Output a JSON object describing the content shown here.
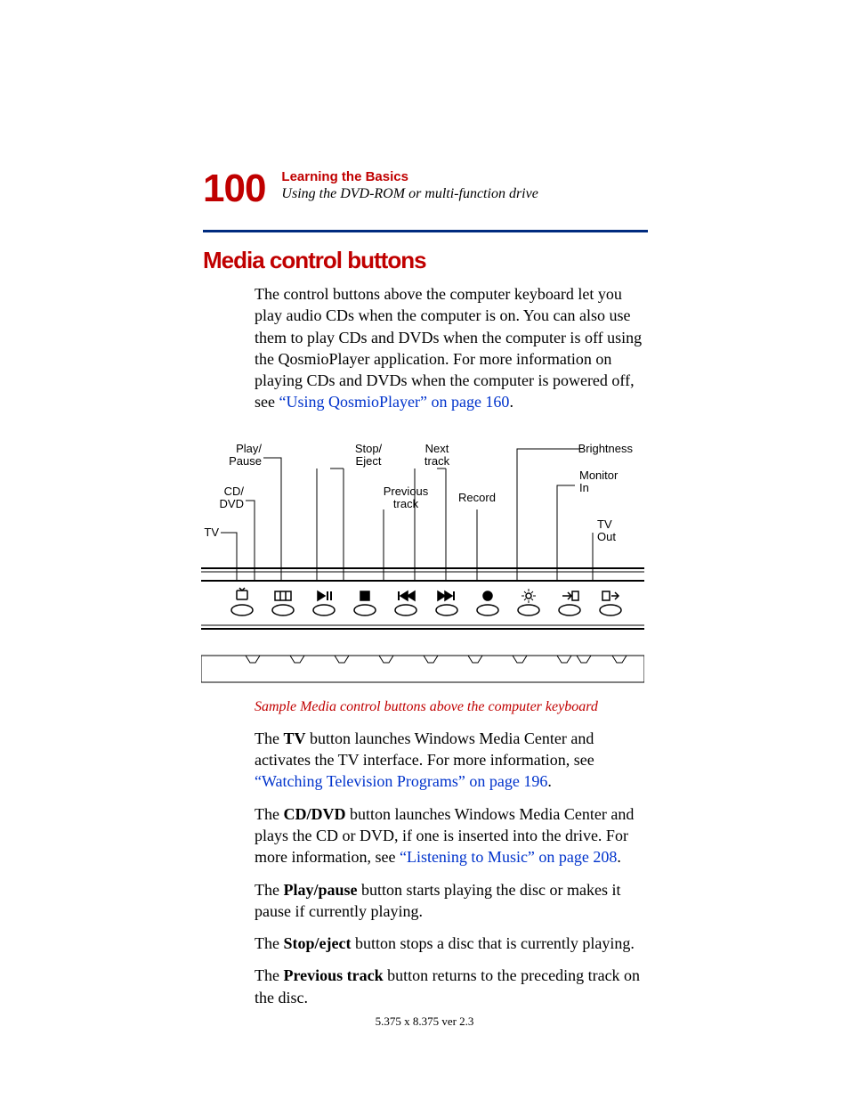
{
  "header": {
    "page_number": "100",
    "chapter_title": "Learning the Basics",
    "section_subtitle": "Using the DVD-ROM or multi-function drive"
  },
  "section_heading": "Media control buttons",
  "intro_paragraph": {
    "text1": "The control buttons above the computer keyboard let you play audio CDs when the computer is on. You can also use them to play CDs and DVDs when the computer is off using the QosmioPlayer application. For more information on playing CDs and DVDs when the computer is powered off, see ",
    "link": "“Using QosmioPlayer” on page 160",
    "text2": "."
  },
  "diagram": {
    "labels": {
      "tv": "TV",
      "cd_dvd1": "CD/",
      "cd_dvd2": "DVD",
      "play1": "Play/",
      "play2": "Pause",
      "stop1": "Stop/",
      "stop2": "Eject",
      "prev1": "Previous",
      "prev2": "track",
      "next1": "Next",
      "next2": "track",
      "record": "Record",
      "brightness": "Brightness",
      "monitor1": "Monitor",
      "monitor2": "In",
      "tvout1": "TV",
      "tvout2": "Out"
    },
    "caption": "Sample Media control buttons above the computer keyboard"
  },
  "paragraphs": {
    "p1": {
      "pre": "The ",
      "bold": "TV",
      "post": " button launches Windows Media Center and activates the TV interface. For more information, see ",
      "link": "“Watching Television Programs” on page 196",
      "tail": "."
    },
    "p2": {
      "pre": "The ",
      "bold": "CD/DVD",
      "post": " button launches Windows Media Center and plays the CD or DVD, if one is inserted into the drive. For more information, see ",
      "link": "“Listening to Music” on page 208",
      "tail": "."
    },
    "p3": {
      "pre": "The ",
      "bold": "Play/pause",
      "post": " button starts playing the disc or makes it pause if currently playing."
    },
    "p4": {
      "pre": "The ",
      "bold": "Stop/eject",
      "post": " button stops a disc that is currently playing."
    },
    "p5": {
      "pre": "The ",
      "bold": "Previous track",
      "post": " button returns to the preceding track on the disc."
    }
  },
  "footer": "5.375 x 8.375 ver 2.3"
}
